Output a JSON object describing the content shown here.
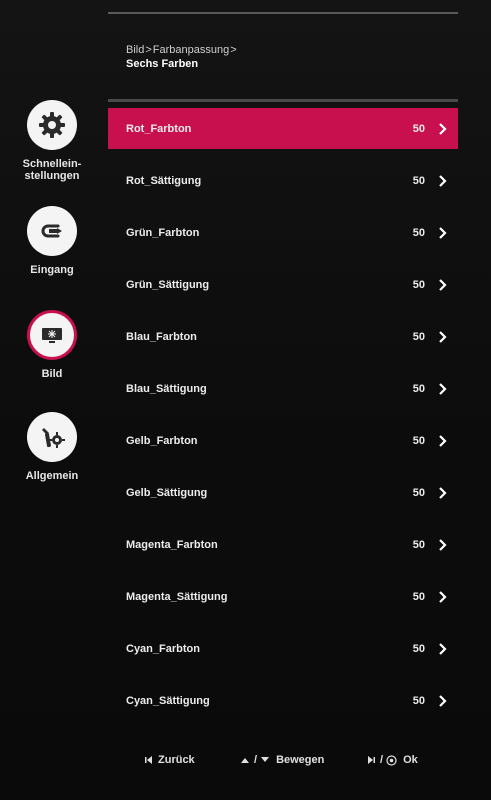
{
  "sidebar": {
    "items": [
      {
        "label_line1": "Schnellein-",
        "label_line2": "stellungen",
        "icon": "gear-icon",
        "active": false
      },
      {
        "label_line1": "Eingang",
        "label_line2": "",
        "icon": "input-icon",
        "active": false
      },
      {
        "label_line1": "Bild",
        "label_line2": "",
        "icon": "picture-icon",
        "active": true
      },
      {
        "label_line1": "Allgemein",
        "label_line2": "",
        "icon": "wrench-gear-icon",
        "active": false
      }
    ]
  },
  "header": {
    "breadcrumb": [
      "Bild",
      "Farbanpassung"
    ],
    "subtitle": "Sechs Farben"
  },
  "rows": [
    {
      "label": "Rot_Farbton",
      "value": "50"
    },
    {
      "label": "Rot_Sättigung",
      "value": "50"
    },
    {
      "label": "Grün_Farbton",
      "value": "50"
    },
    {
      "label": "Grün_Sättigung",
      "value": "50"
    },
    {
      "label": "Blau_Farbton",
      "value": "50"
    },
    {
      "label": "Blau_Sättigung",
      "value": "50"
    },
    {
      "label": "Gelb_Farbton",
      "value": "50"
    },
    {
      "label": "Gelb_Sättigung",
      "value": "50"
    },
    {
      "label": "Magenta_Farbton",
      "value": "50"
    },
    {
      "label": "Magenta_Sättigung",
      "value": "50"
    },
    {
      "label": "Cyan_Farbton",
      "value": "50"
    },
    {
      "label": "Cyan_Sättigung",
      "value": "50"
    }
  ],
  "footer": {
    "back": "Zurück",
    "move_separator": "/",
    "move": "Bewegen",
    "ok_separator": "/",
    "ok": "Ok"
  },
  "colors": {
    "accent": "#c8104e",
    "background": "#0c0c0c"
  }
}
